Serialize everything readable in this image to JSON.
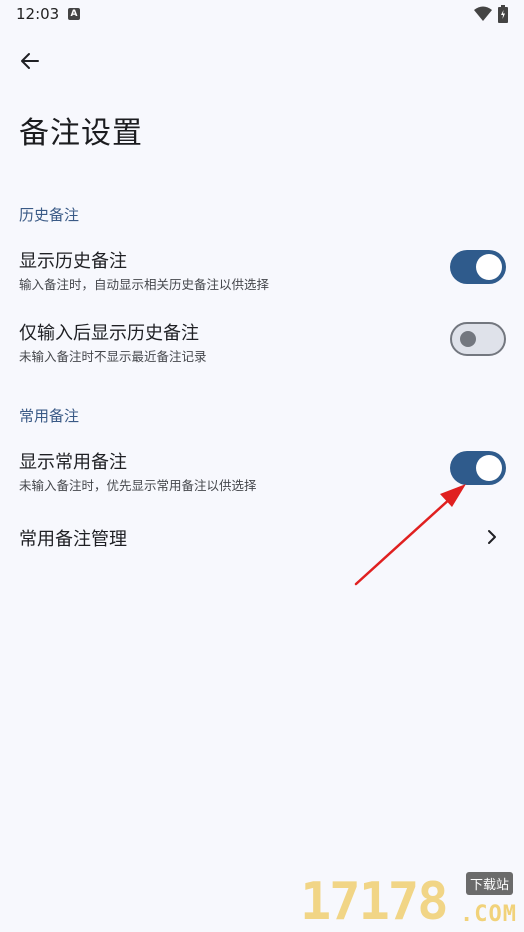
{
  "status_bar": {
    "time": "12:03",
    "indicator": "A"
  },
  "header": {
    "title": "备注设置",
    "back_icon": "arrow-back-icon"
  },
  "sections": [
    {
      "header": "历史备注",
      "items": [
        {
          "title": "显示历史备注",
          "subtitle": "输入备注时，自动显示相关历史备注以供选择",
          "toggle": true
        },
        {
          "title": "仅输入后显示历史备注",
          "subtitle": "未输入备注时不显示最近备注记录",
          "toggle": false
        }
      ]
    },
    {
      "header": "常用备注",
      "items": [
        {
          "title": "显示常用备注",
          "subtitle": "未输入备注时，优先显示常用备注以供选择",
          "toggle": true
        },
        {
          "title": "常用备注管理",
          "chevron_icon": "chevron-right-icon"
        }
      ]
    }
  ],
  "watermark": {
    "digits": "17178",
    "tag": "下载站",
    "domain": ".COM"
  },
  "colors": {
    "accent": "#2f5b8c",
    "section_header": "#3a5a86",
    "background": "#f7f8fd",
    "annotation_arrow": "#e02020"
  }
}
